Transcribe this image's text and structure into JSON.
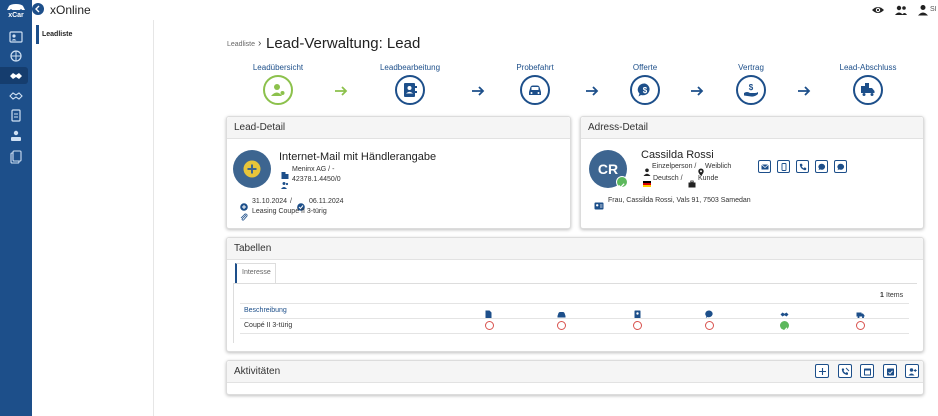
{
  "app": {
    "logo_text": "xCar",
    "title": "xOnline",
    "user_initials": "SI"
  },
  "leftnav": {
    "items": [
      {
        "label": "Leadliste"
      }
    ]
  },
  "breadcrumb": {
    "parent": "Leadliste",
    "separator": "›",
    "title": "Lead-Verwaltung: Lead"
  },
  "steps": [
    {
      "label": "Leadübersicht",
      "icon": "user-pin-icon",
      "active": true
    },
    {
      "label": "Leadbearbeitung",
      "icon": "contact-book-icon"
    },
    {
      "label": "Probefahrt",
      "icon": "car-icon"
    },
    {
      "label": "Offerte",
      "icon": "dollar-bubble-icon"
    },
    {
      "label": "Vertrag",
      "icon": "hand-money-icon"
    },
    {
      "label": "Lead-Abschluss",
      "icon": "truck-box-icon"
    }
  ],
  "lead_detail": {
    "title": "Lead-Detail",
    "source": "Internet-Mail mit Händlerangabe",
    "company": "Meninx AG / -",
    "lead_number": "42378.1.4450/0",
    "date_created": "31.10.2024",
    "date_separator": "/",
    "date_due": "06.11.2024",
    "interest": "Leasing Coupé II 3-türig"
  },
  "adress_detail": {
    "title": "Adress-Detail",
    "initials": "CR",
    "name": "Cassilda Rossi",
    "person_type": "Einzelperson / ",
    "gender": "Weiblich",
    "language": "Deutsch / ",
    "role": "Kunde",
    "address": "Frau, Cassilda Rossi, Vals 91, 7503 Samedan",
    "contact_buttons": [
      "mail-icon",
      "mobile-icon",
      "phone-icon",
      "chat-icon",
      "message-icon"
    ]
  },
  "tabellen": {
    "title": "Tabellen",
    "tab": "Interesse",
    "count": "1",
    "count_label": "Items",
    "column_header": "Beschreibung",
    "row_label": "Coupé II 3-türig",
    "status": [
      "no",
      "no",
      "no",
      "no",
      "yes",
      "no"
    ]
  },
  "aktivitaeten": {
    "title": "Aktivitäten",
    "buttons": [
      "add-icon",
      "call-transfer-icon",
      "calendar-icon",
      "calendar-check-icon",
      "add-user-icon"
    ]
  },
  "colors": {
    "brand": "#1d4f8a",
    "accent_green": "#8cc14c",
    "status_red": "#d9534f",
    "status_green": "#5cb85c",
    "lead_avatar_icon": "#e8c53a"
  }
}
